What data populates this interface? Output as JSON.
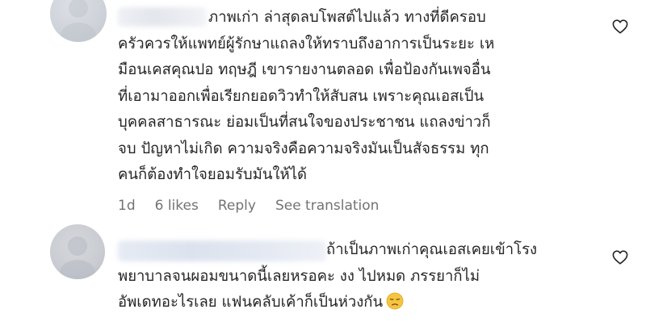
{
  "comments": [
    {
      "lines": [
        "ภาพเก่า ล่าสุดลบโพสต์ไปแล้ว ทางที่ดีครอบ",
        "ครัวควรให้แพทย์ผู้รักษาแถลงให้ทราบถึงอาการเป็นระยะ เห",
        "มือนเคสคุณปอ ทฤษฎี เขารายงานตลอด เพื่อป้องกันเพจอื่น",
        "ที่เอามาออกเพื่อเรียกยอดวิวทำให้สับสน เพราะคุณเอสเป็น",
        "บุคคลสาธารณะ ย่อมเป็นที่สนใจของประชาชน แถลงข่าวก็",
        "จบ ปัญหาไม่เกิด ความจริงคือความจริงมันเป็นสัจธรรม ทุก",
        "คนก็ต้องทำใจยอมรับมันให้ได้"
      ],
      "time": "1d",
      "likes": "6 likes",
      "reply": "Reply",
      "translate": "See translation",
      "like_icon": "heart-outline-icon"
    },
    {
      "lines": [
        "ถ้าเป็นภาพเก่าคุณเอสเคยเข้าโรง",
        "พยาบาลจนผอมขนาดนี้เลยหรอคะ งง ไปหมด ภรรยาก็ไม่",
        "อัพเดทอะไรเลย แฟนคลับเค้าก็เป็นห่วงกัน"
      ],
      "emoji": "pensive-face-emoji",
      "like_icon": "heart-outline-icon"
    }
  ],
  "colors": {
    "text": "#262626",
    "meta": "#737373"
  }
}
